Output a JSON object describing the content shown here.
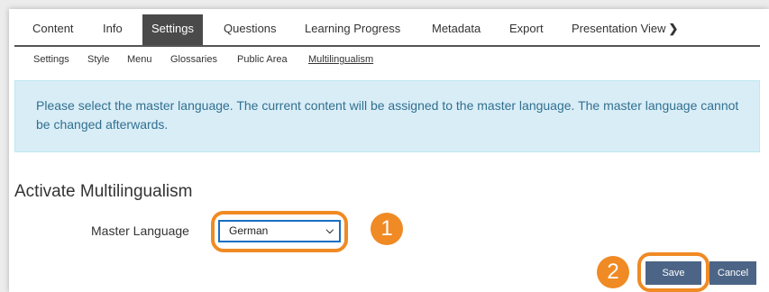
{
  "main_tabs": [
    {
      "label": "Content"
    },
    {
      "label": "Info"
    },
    {
      "label": "Settings"
    },
    {
      "label": "Questions"
    },
    {
      "label": "Learning Progress"
    },
    {
      "label": "Metadata"
    },
    {
      "label": "Export"
    },
    {
      "label": "Presentation View"
    }
  ],
  "active_main_tab": "Settings",
  "sub_tabs": [
    {
      "label": "Settings"
    },
    {
      "label": "Style"
    },
    {
      "label": "Menu"
    },
    {
      "label": "Glossaries"
    },
    {
      "label": "Public Area"
    },
    {
      "label": "Multilingualism"
    }
  ],
  "active_sub_tab": "Multilingualism",
  "info_message": "Please select the master language. The current content will be assigned to the master language. The master language cannot be changed afterwards.",
  "section_title": "Activate Multilingualism",
  "form": {
    "master_language_label": "Master Language",
    "master_language_value": "German"
  },
  "callouts": {
    "step1": "1",
    "step2": "2"
  },
  "buttons": {
    "save": "Save",
    "cancel": "Cancel"
  },
  "colors": {
    "highlight": "#f08a24",
    "active_tab": "#4a4a4a",
    "info_bg": "#d9edf7",
    "button": "#4c6586"
  }
}
